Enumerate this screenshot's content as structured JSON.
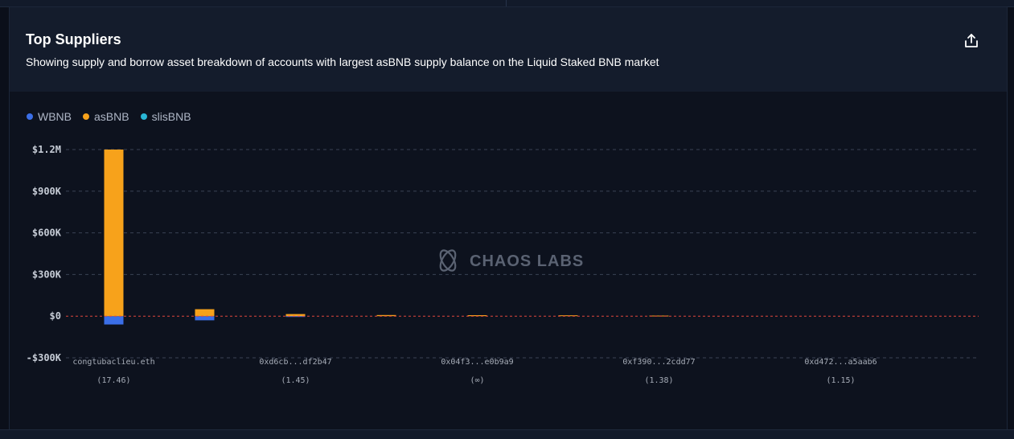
{
  "card": {
    "title": "Top Suppliers",
    "subtitle": "Showing supply and borrow asset breakdown of accounts with largest asBNB supply balance on the Liquid Staked BNB market"
  },
  "watermark": "CHAOS LABS",
  "icons": {
    "export": "share-export-icon",
    "watermark": "chaos-labs-logo-icon"
  },
  "colors": {
    "WBNB": "#3b6fe8",
    "asBNB": "#f7a21b",
    "slisBNB": "#29b6d6",
    "zero_line": "#e0463c"
  },
  "chart_data": {
    "type": "bar",
    "stacked": true,
    "ylim": [
      -300000,
      1200000
    ],
    "yticks": [
      {
        "value": 1200000,
        "label": "$1.2M"
      },
      {
        "value": 900000,
        "label": "$900K"
      },
      {
        "value": 600000,
        "label": "$600K"
      },
      {
        "value": 300000,
        "label": "$300K"
      },
      {
        "value": 0,
        "label": "$0"
      },
      {
        "value": -300000,
        "label": "-$300K"
      }
    ],
    "grid": true,
    "legend_position": "top-left",
    "x_labels": [
      {
        "index": 0,
        "name": "congtubaclieu.eth",
        "value": "(17.46)"
      },
      {
        "index": 2,
        "name": "0xd6cb...df2b47",
        "value": "(1.45)"
      },
      {
        "index": 4,
        "name": "0x04f3...e0b9a9",
        "value": "(∞)"
      },
      {
        "index": 6,
        "name": "0xf390...2cdd77",
        "value": "(1.38)"
      },
      {
        "index": 8,
        "name": "0xd472...a5aab6",
        "value": "(1.15)"
      }
    ],
    "series": [
      {
        "name": "WBNB",
        "values": [
          -60000,
          -30000,
          -5000,
          0,
          0,
          0,
          0,
          0,
          0,
          0
        ]
      },
      {
        "name": "asBNB",
        "values": [
          1200000,
          50000,
          15000,
          8000,
          7000,
          6000,
          4000,
          0,
          0,
          0
        ]
      },
      {
        "name": "slisBNB",
        "values": [
          0,
          0,
          0,
          0,
          0,
          0,
          0,
          0,
          0,
          0
        ]
      }
    ]
  }
}
